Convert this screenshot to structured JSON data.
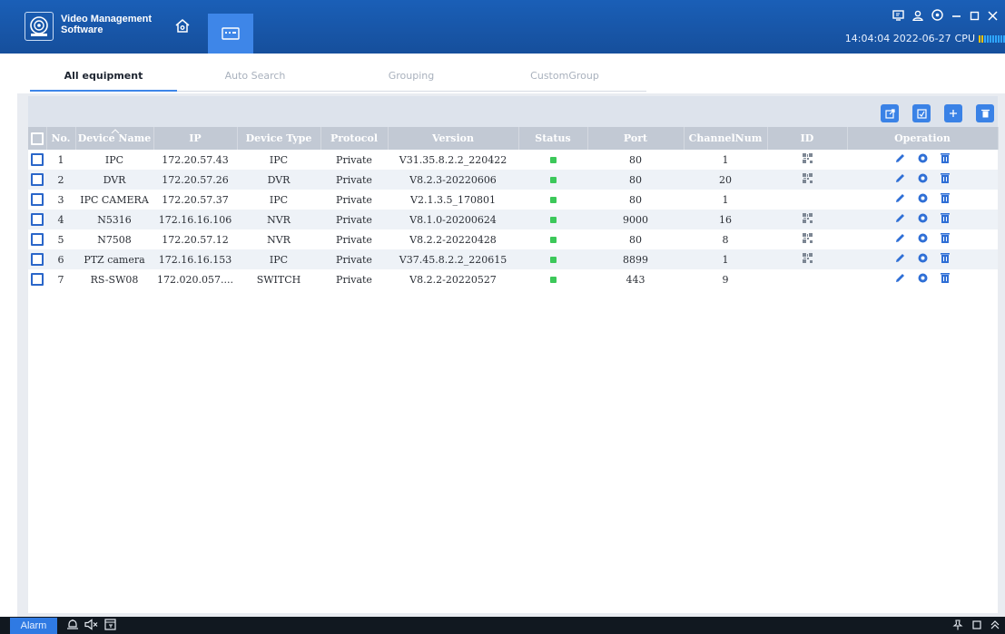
{
  "app": {
    "title_line1": "Video Management",
    "title_line2": "Software",
    "clock": "14:04:04 2022-06-27",
    "cpu_label": "CPU"
  },
  "tabs": [
    {
      "label": "All equipment",
      "active": true
    },
    {
      "label": "Auto Search",
      "active": false
    },
    {
      "label": "Grouping",
      "active": false
    },
    {
      "label": "CustomGroup",
      "active": false
    }
  ],
  "table": {
    "columns": [
      "No.",
      "Device Name",
      "IP",
      "Device Type",
      "Protocol",
      "Version",
      "Status",
      "Port",
      "ChannelNum",
      "ID",
      "Operation"
    ],
    "rows": [
      {
        "no": "1",
        "name": "IPC",
        "ip": "172.20.57.43",
        "type": "IPC",
        "protocol": "Private",
        "version": "V31.35.8.2.2_220422",
        "online": true,
        "port": "80",
        "channels": "1",
        "has_id": true
      },
      {
        "no": "2",
        "name": "DVR",
        "ip": "172.20.57.26",
        "type": "DVR",
        "protocol": "Private",
        "version": "V8.2.3-20220606",
        "online": true,
        "port": "80",
        "channels": "20",
        "has_id": true
      },
      {
        "no": "3",
        "name": "IPC CAMERA",
        "ip": "172.20.57.37",
        "type": "IPC",
        "protocol": "Private",
        "version": "V2.1.3.5_170801",
        "online": true,
        "port": "80",
        "channels": "1",
        "has_id": false
      },
      {
        "no": "4",
        "name": "N5316",
        "ip": "172.16.16.106",
        "type": "NVR",
        "protocol": "Private",
        "version": "V8.1.0-20200624",
        "online": true,
        "port": "9000",
        "channels": "16",
        "has_id": true
      },
      {
        "no": "5",
        "name": "N7508",
        "ip": "172.20.57.12",
        "type": "NVR",
        "protocol": "Private",
        "version": "V8.2.2-20220428",
        "online": true,
        "port": "80",
        "channels": "8",
        "has_id": true
      },
      {
        "no": "6",
        "name": "PTZ camera",
        "ip": "172.16.16.153",
        "type": "IPC",
        "protocol": "Private",
        "version": "V37.45.8.2.2_220615",
        "online": true,
        "port": "8899",
        "channels": "1",
        "has_id": true
      },
      {
        "no": "7",
        "name": "RS-SW08",
        "ip": "172.020.057....",
        "type": "SWITCH",
        "protocol": "Private",
        "version": "V8.2.2-20220527",
        "online": true,
        "port": "443",
        "channels": "9",
        "has_id": false
      }
    ]
  },
  "toolbar": {
    "buttons": [
      "export-icon",
      "import-icon",
      "add-icon",
      "delete-icon"
    ]
  },
  "bottombar": {
    "alarm_label": "Alarm"
  },
  "colors": {
    "titlebar": "#1a5fb7",
    "accent": "#3a82e6",
    "status_online": "#3cc85a",
    "header_row": "#c2c9d4"
  }
}
